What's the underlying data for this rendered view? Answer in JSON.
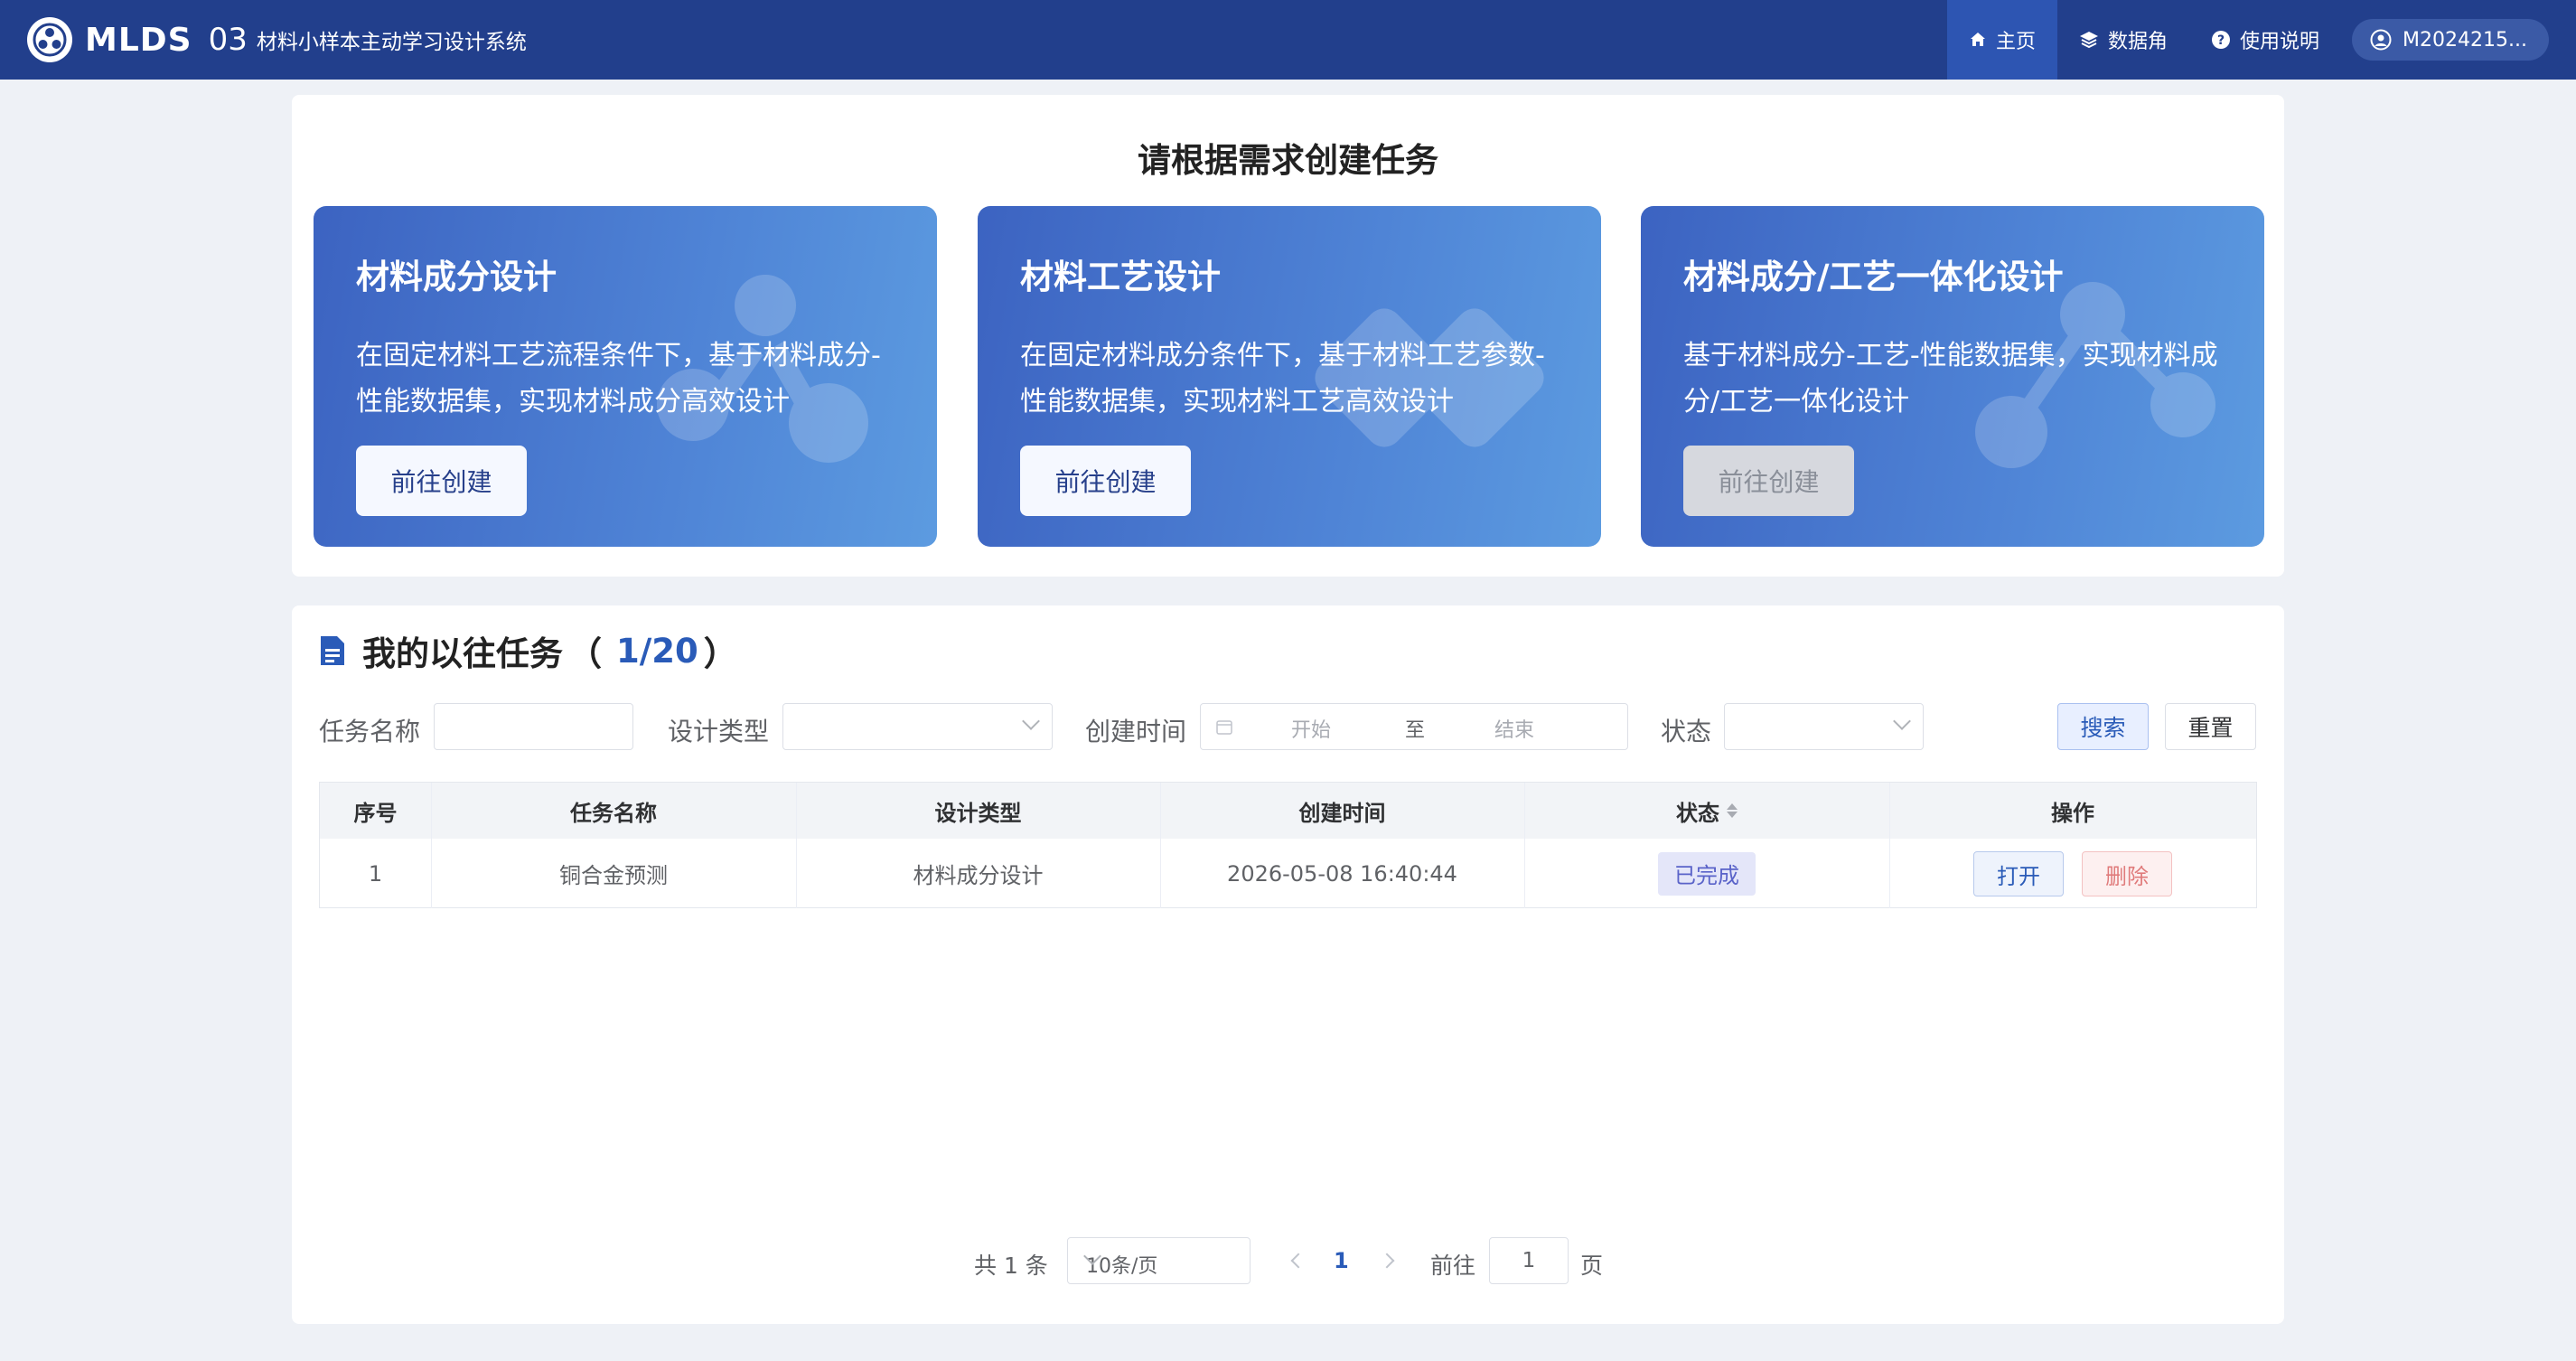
{
  "header": {
    "brand": "MLDS",
    "num": "03",
    "subtitle": "材料小样本主动学习设计系统",
    "nav": [
      {
        "label": "主页",
        "icon": "home-icon",
        "active": true
      },
      {
        "label": "数据角",
        "icon": "layers-icon",
        "active": false
      },
      {
        "label": "使用说明",
        "icon": "help-icon",
        "active": false
      }
    ],
    "user": "M2024215..."
  },
  "create": {
    "title": "请根据需求创建任务",
    "cards": [
      {
        "title": "材料成分设计",
        "desc": "在固定材料工艺流程条件下，基于材料成分-性能数据集，实现材料成分高效设计",
        "button": "前往创建",
        "disabled": false
      },
      {
        "title": "材料工艺设计",
        "desc": "在固定材料成分条件下，基于材料工艺参数-性能数据集，实现材料工艺高效设计",
        "button": "前往创建",
        "disabled": false
      },
      {
        "title": "材料成分/工艺一体化设计",
        "desc": "基于材料成分-工艺-性能数据集，实现材料成分/工艺一体化设计",
        "button": "前往创建",
        "disabled": true
      }
    ]
  },
  "history": {
    "title": "我的以往任务",
    "paren_open": "（",
    "count": "1/20",
    "paren_close": "）",
    "filters": {
      "name_label": "任务名称",
      "type_label": "设计类型",
      "time_label": "创建时间",
      "start_placeholder": "开始",
      "to": "至",
      "end_placeholder": "结束",
      "status_label": "状态",
      "search": "搜索",
      "reset": "重置"
    },
    "columns": [
      "序号",
      "任务名称",
      "设计类型",
      "创建时间",
      "状态",
      "操作"
    ],
    "rows": [
      {
        "index": "1",
        "name": "铜合金预测",
        "type": "材料成分设计",
        "created": "2026-05-08 16:40:44",
        "status": "已完成",
        "open": "打开",
        "delete": "删除"
      }
    ],
    "pagination": {
      "total": "共 1 条",
      "page_size": "10条/页",
      "current": "1",
      "goto": "前往",
      "goto_value": "1",
      "page_unit": "页"
    }
  },
  "colors": {
    "header_bg": "#223f8c",
    "accent": "#2a5bb8",
    "card_gradient_start": "#3c63c1",
    "card_gradient_end": "#5c9be0"
  }
}
